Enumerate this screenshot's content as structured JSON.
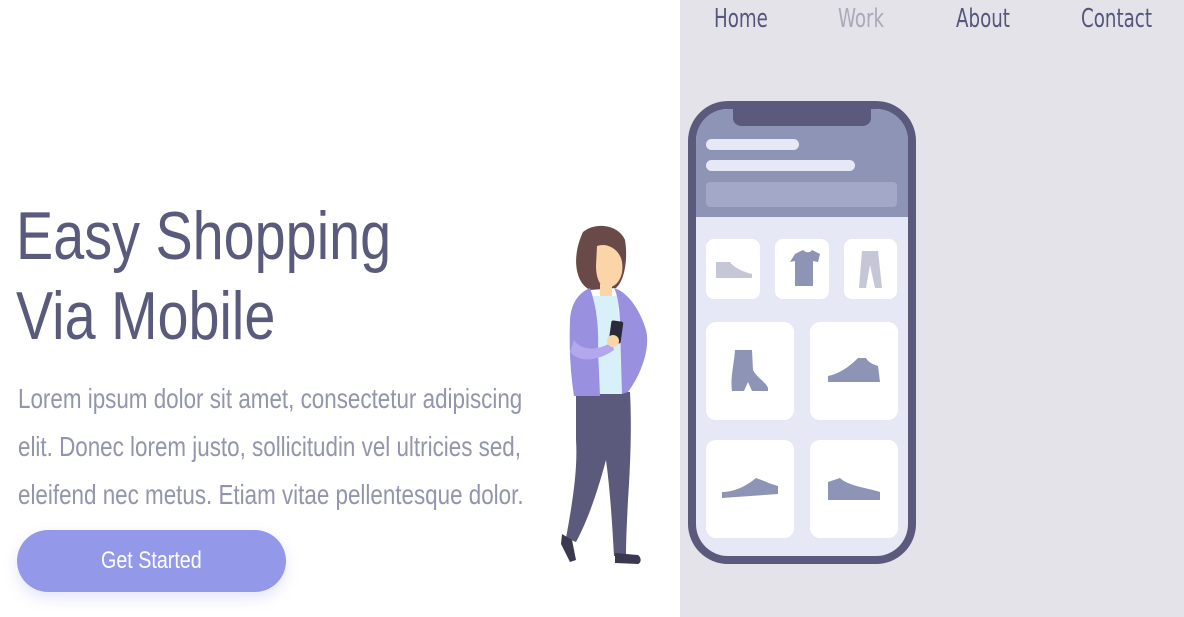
{
  "nav": {
    "items": [
      {
        "label": "Home",
        "active": false
      },
      {
        "label": "Work",
        "active": true
      },
      {
        "label": "About",
        "active": false
      },
      {
        "label": "Contact",
        "active": false
      }
    ]
  },
  "hero": {
    "title_lines": [
      "Easy Shopping",
      "Via Mobile"
    ],
    "body_lines": [
      "Lorem ipsum dolor sit amet, consectetur adipiscing",
      "elit. Donec lorem justo, sollicitudin vel ultricies sed,",
      "eleifend nec metus. Etiam vitae pellentesque dolor."
    ],
    "cta_label": "Get Started"
  },
  "illustration": {
    "phone_products": [
      "sneaker-icon",
      "tshirt-icon",
      "pants-icon",
      "boot-icon",
      "shoe-icon",
      "sneaker-icon",
      "sneaker-icon"
    ],
    "colors": {
      "panel": "#e4e3ea",
      "phone_frame": "#5b5a7d",
      "phone_header": "#8e94b6",
      "product_icon": "#8e94b6",
      "accent": "#9399e8"
    }
  }
}
